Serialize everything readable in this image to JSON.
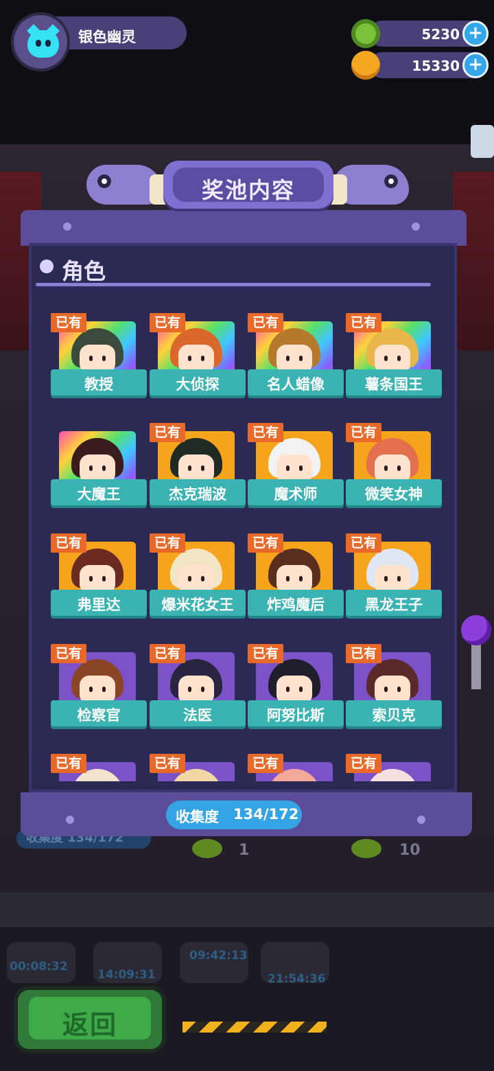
{
  "profile": {
    "name": "银色幽灵",
    "avatar_icon": "ghost-cat-icon"
  },
  "currencies": [
    {
      "icon": "gem-ring-icon",
      "value": "5230"
    },
    {
      "icon": "planet-coin-icon",
      "value": "15330"
    }
  ],
  "panel": {
    "title": "奖池内容",
    "section_title": "角色",
    "collection_label": "收集度",
    "collection_value": "134/172"
  },
  "characters": [
    {
      "name": "教授",
      "owned_label": "已有",
      "rarity": "rainbow",
      "hair": "#3b4a3a"
    },
    {
      "name": "大侦探",
      "owned_label": "已有",
      "rarity": "rainbow",
      "hair": "#d9682a"
    },
    {
      "name": "名人蜡像",
      "owned_label": "已有",
      "rarity": "rainbow",
      "hair": "#b57a2c"
    },
    {
      "name": "薯条国王",
      "owned_label": "已有",
      "rarity": "rainbow",
      "hair": "#e8b64a"
    },
    {
      "name": "大魔王",
      "owned_label": "",
      "rarity": "rainbow",
      "hair": "#3a1c1c"
    },
    {
      "name": "杰克瑞波",
      "owned_label": "已有",
      "rarity": "gold",
      "hair": "#1f2a22"
    },
    {
      "name": "魔术师",
      "owned_label": "已有",
      "rarity": "gold",
      "hair": "#f2f2f2"
    },
    {
      "name": "微笑女神",
      "owned_label": "已有",
      "rarity": "gold",
      "hair": "#e2704e"
    },
    {
      "name": "弗里达",
      "owned_label": "已有",
      "rarity": "gold",
      "hair": "#6b2a22"
    },
    {
      "name": "爆米花女王",
      "owned_label": "已有",
      "rarity": "gold",
      "hair": "#f4e6c4"
    },
    {
      "name": "炸鸡魔后",
      "owned_label": "已有",
      "rarity": "gold",
      "hair": "#5a2e1e"
    },
    {
      "name": "黑龙王子",
      "owned_label": "已有",
      "rarity": "gold",
      "hair": "#dfe6f4"
    },
    {
      "name": "检察官",
      "owned_label": "已有",
      "rarity": "purple",
      "hair": "#8a4526"
    },
    {
      "name": "法医",
      "owned_label": "已有",
      "rarity": "purple",
      "hair": "#2a2440"
    },
    {
      "name": "阿努比斯",
      "owned_label": "已有",
      "rarity": "purple",
      "hair": "#1e1e2c"
    },
    {
      "name": "索贝克",
      "owned_label": "已有",
      "rarity": "purple",
      "hair": "#5a2a2a"
    },
    {
      "name": "",
      "owned_label": "已有",
      "rarity": "purple",
      "hair": "#f2e4cc"
    },
    {
      "name": "",
      "owned_label": "已有",
      "rarity": "purple",
      "hair": "#f2d8a4"
    },
    {
      "name": "",
      "owned_label": "已有",
      "rarity": "purple",
      "hair": "#f4a89a"
    },
    {
      "name": "",
      "owned_label": "已有",
      "rarity": "purple",
      "hair": "#f8e0e0"
    }
  ],
  "background": {
    "collection_ghost": "收集度 134/172",
    "counter_left": "1",
    "counter_right": "10",
    "timers": [
      "00:08:32",
      "14:09:31",
      "09:42:13",
      "21:54:36"
    ]
  },
  "back_button": {
    "label": "返回"
  }
}
